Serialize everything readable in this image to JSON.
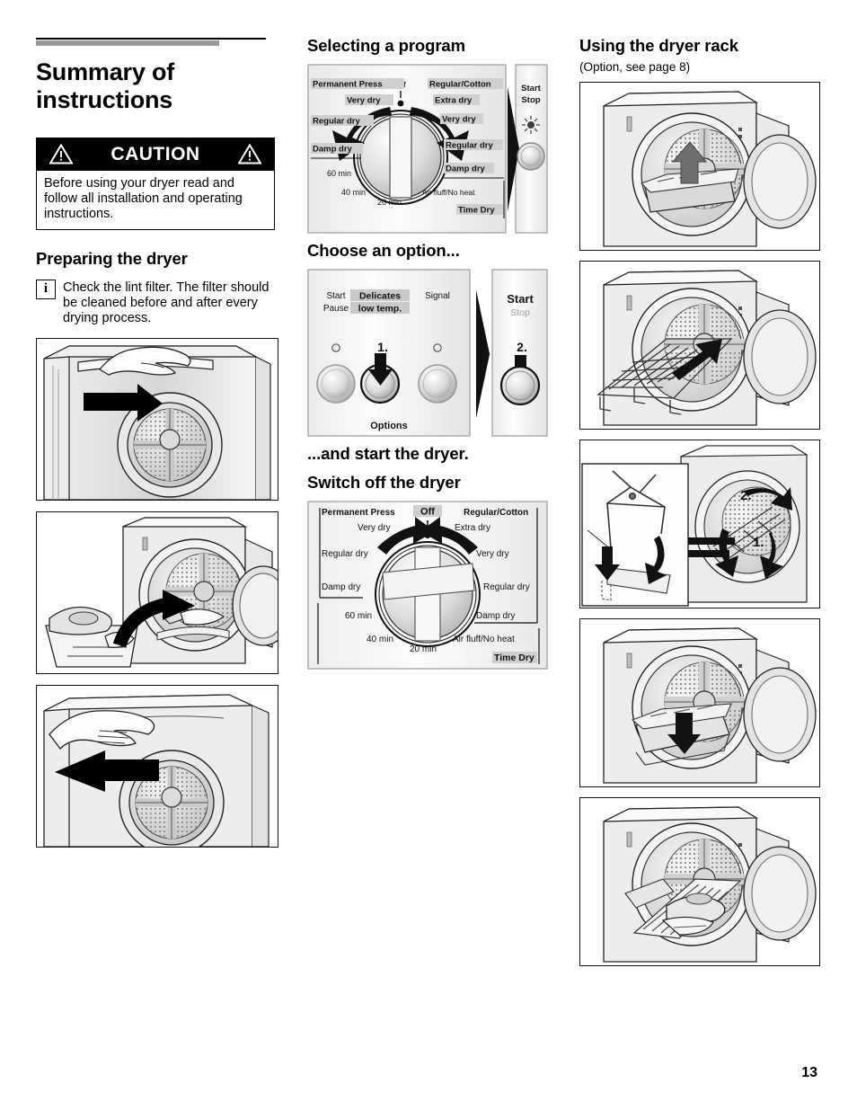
{
  "page_number": "13",
  "left": {
    "title": "Summary of\ninstructions",
    "title_line1": "Summary of",
    "title_line2": "instructions",
    "caution": {
      "label": "CAUTION",
      "icon_left": "warning-triangle-icon",
      "icon_right": "warning-triangle-icon",
      "text": "Before using your dryer read and follow all installation and operating instructions."
    },
    "preparing_heading": "Preparing the dryer",
    "note": {
      "icon": "info-icon",
      "marker": "i",
      "text": "Check the lint filter. The filter should be cleaned before and after every drying process."
    },
    "figures": [
      {
        "name": "figure-open-door",
        "caption": ""
      },
      {
        "name": "figure-load-laundry",
        "caption": ""
      },
      {
        "name": "figure-close-door",
        "caption": ""
      }
    ]
  },
  "middle": {
    "heading_select": "Selecting a program",
    "heading_option": "Choose an option...",
    "heading_start": "...and start the dryer.",
    "heading_switch_off": "Switch off the dryer",
    "program_dial": {
      "off_label": "Off",
      "left_group_title": "Permanent Press",
      "right_group_title": "Regular/Cotton",
      "left_labels": [
        "Very dry",
        "Regular dry",
        "Damp dry"
      ],
      "right_labels": [
        "Extra dry",
        "Very dry",
        "Regular dry",
        "Damp dry"
      ],
      "time_labels": [
        "60 min",
        "40 min",
        "20 min"
      ],
      "air_fluff": "Air fluff/No heat",
      "time_dry": "Time Dry",
      "start_stop": {
        "line1": "Start",
        "line2": "Stop"
      }
    },
    "options_panel": {
      "buttons": [
        {
          "line1": "Start",
          "line2": "Pause",
          "highlight": false
        },
        {
          "line1": "Delicates",
          "line2": "low temp.",
          "highlight": true
        },
        {
          "line1": "Signal",
          "line2": "",
          "highlight": false
        }
      ],
      "footer_label": "Options",
      "step_label": "1.",
      "start_panel": {
        "line1": "Start",
        "line2": "Stop",
        "step_label": "2."
      }
    },
    "switch_off_dial": {
      "off_label": "Off",
      "left_group_title": "Permanent Press",
      "right_group_title": "Regular/Cotton",
      "left_labels": [
        "Very dry",
        "Regular dry",
        "Damp dry"
      ],
      "right_labels": [
        "Extra dry",
        "Very dry",
        "Regular dry",
        "Damp dry"
      ],
      "time_labels": [
        "60 min",
        "40 min",
        "20 min"
      ],
      "air_fluff": "Air fluff/No heat",
      "time_dry": "Time Dry"
    }
  },
  "right": {
    "heading": "Using the dryer rack",
    "subheading": "(Option, see page 8)",
    "figures": [
      {
        "name": "figure-rack-lift-filter-cover",
        "steps": []
      },
      {
        "name": "figure-insert-rack",
        "steps": []
      },
      {
        "name": "figure-rack-hooks-detail",
        "steps": [
          "2.",
          "1."
        ]
      },
      {
        "name": "figure-rack-push-down",
        "steps": []
      },
      {
        "name": "figure-rack-with-shoes",
        "steps": []
      }
    ]
  }
}
